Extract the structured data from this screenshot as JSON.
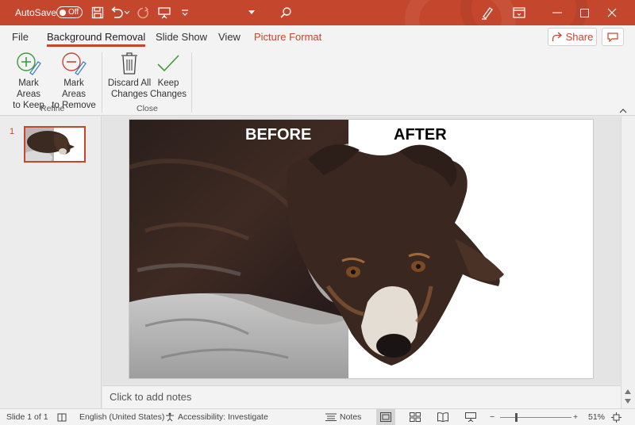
{
  "titlebar": {
    "autosave_label": "AutoSave",
    "autosave_state": "Off",
    "accent_color": "#c4472d"
  },
  "tabs": [
    {
      "label": "File"
    },
    {
      "label": "Background Removal"
    },
    {
      "label": "Slide Show"
    },
    {
      "label": "View"
    },
    {
      "label": "Picture Format"
    }
  ],
  "share_label": "Share",
  "ribbon": {
    "mark_keep": {
      "line1": "Mark Areas",
      "line2": "to Keep"
    },
    "mark_remove": {
      "line1": "Mark Areas",
      "line2": "to Remove"
    },
    "discard": {
      "line1": "Discard All",
      "line2": "Changes"
    },
    "keep": {
      "line1": "Keep",
      "line2": "Changes"
    },
    "group_refine": "Refine",
    "group_close": "Close"
  },
  "thumbnails": [
    {
      "number": "1"
    }
  ],
  "slide": {
    "before_label": "BEFORE",
    "after_label": "AFTER"
  },
  "notes_placeholder": "Click to add notes",
  "status": {
    "slide_info": "Slide 1 of 1",
    "language": "English (United States)",
    "accessibility": "Accessibility: Investigate",
    "notes_label": "Notes",
    "zoom": "51%"
  }
}
